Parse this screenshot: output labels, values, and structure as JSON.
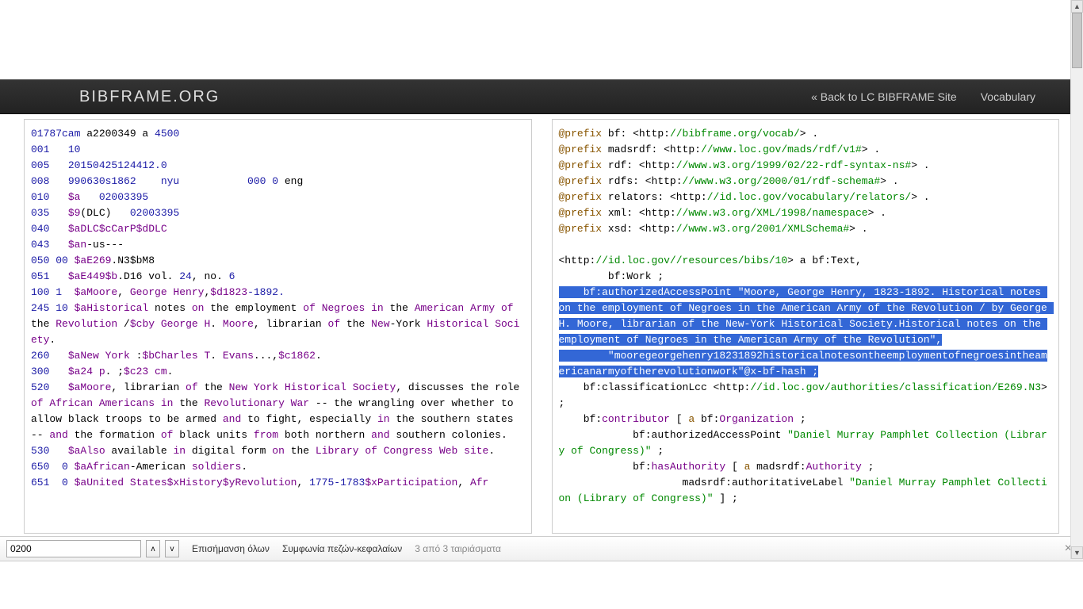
{
  "navbar": {
    "brand": "BIBFRAME.ORG",
    "back_link": "« Back to LC BIBFRAME Site",
    "vocab_link": "Vocabulary"
  },
  "marc": {
    "l1_a": "01787cam ",
    "l1_b": "a2200349 a ",
    "l1_c": "4500",
    "l2_a": "001   ",
    "l2_b": "10",
    "l3_a": "005   ",
    "l3_b": "20150425124412.0",
    "l4_a": "008   ",
    "l4_b": "990630s1862    nyu           000 0 ",
    "l4_c": "eng",
    "l5_a": "010   ",
    "l5_b": "$a   ",
    "l5_c": "02003395",
    "l6_a": "035   ",
    "l6_b": "$9",
    "l6_c": "(DLC)   ",
    "l6_d": "02003395",
    "l7_a": "040   ",
    "l7_b": "$aDLC$cCarP$dDLC",
    "l8_a": "043   ",
    "l8_b": "$an",
    "l8_c": "-us---",
    "l9_a": "050 00 ",
    "l9_b": "$aE269",
    "l9_c": ".N3$bM8",
    "l10_a": "051   ",
    "l10_b": "$aE449$b",
    "l10_c": ".D16 vol. ",
    "l10_d": "24",
    "l10_e": ", no. ",
    "l10_f": "6",
    "l11_a": "100 1  ",
    "l11_b": "$aMoore",
    "l11_c": ", ",
    "l11_d": "George Henry",
    "l11_e": ",",
    "l11_f": "$d1823",
    "l11_g": "-1892.",
    "l12_a": "245 10 ",
    "l12_b": "$aHistorical ",
    "l12_c": "notes ",
    "l12_d": "on ",
    "l12_e": "the ",
    "l12_f": "employment ",
    "l12_g": "of ",
    "l12_h": "Negroes ",
    "l12_i": "in ",
    "l12_j": "the ",
    "l12_k": "American Army ",
    "l12_l": "of ",
    "l12_m": "the ",
    "l12_n": "Revolution ",
    "l12_o": "/",
    "l12_p": "$cby George H",
    "l12_q": ". ",
    "l12_r": "Moore",
    "l12_s": ", ",
    "l12_t": "librarian ",
    "l12_u": "of ",
    "l12_v": "the ",
    "l12_w": "New",
    "l12_x": "-York ",
    "l12_y": "Historical Society",
    "l12_z": ".",
    "l13_a": "260   ",
    "l13_b": "$aNew York ",
    "l13_c": ":",
    "l13_d": "$bCharles T",
    "l13_e": ". ",
    "l13_f": "Evans",
    "l13_g": "...,",
    "l13_h": "$c1862",
    "l13_i": ".",
    "l14_a": "300   ",
    "l14_b": "$a24 p",
    "l14_c": ". ;",
    "l14_d": "$c23 cm",
    "l14_e": ".",
    "l15_a": "520   ",
    "l15_b": "$aMoore",
    "l15_c": ", ",
    "l15_d": "librarian ",
    "l15_e": "of ",
    "l15_f": "the ",
    "l15_g": "New York Historical Society",
    "l15_h": ", ",
    "l15_i": "discusses ",
    "l15_j": "the ",
    "l15_k": "role ",
    "l15_l": "of ",
    "l15_m": "African Americans in ",
    "l15_n": "the ",
    "l15_o": "Revolutionary War ",
    "l15_p": "-- ",
    "l15_q": "the ",
    "l15_r": "wrangling ",
    "l15_s": "over ",
    "l15_t": "whether ",
    "l15_u": "to ",
    "l15_v": "allow ",
    "l15_w": "black ",
    "l15_x": "troops ",
    "l15_y": "to ",
    "l15_z": "be ",
    "l15_aa": "armed ",
    "l15_ab": "and ",
    "l15_ac": "to ",
    "l15_ad": "fight",
    "l15_ae": ", ",
    "l15_af": "especially ",
    "l15_ag": "in ",
    "l15_ah": "the ",
    "l15_ai": "southern ",
    "l15_aj": "states ",
    "l15_ak": "-- ",
    "l15_al": "and ",
    "l15_am": "the ",
    "l15_an": "formation ",
    "l15_ao": "of ",
    "l15_ap": "black ",
    "l15_aq": "units ",
    "l15_ar": "from ",
    "l15_as": "both ",
    "l15_at": "northern ",
    "l15_au": "and ",
    "l15_av": "southern ",
    "l15_aw": "colonies",
    "l15_ax": ".",
    "l16_a": "530   ",
    "l16_b": "$aAlso ",
    "l16_c": "available ",
    "l16_d": "in ",
    "l16_e": "digital ",
    "l16_f": "form ",
    "l16_g": "on ",
    "l16_h": "the ",
    "l16_i": "Library ",
    "l16_j": "of ",
    "l16_k": "Congress Web site",
    "l16_l": ".",
    "l17_a": "650  0 ",
    "l17_b": "$aAfrican",
    "l17_c": "-American ",
    "l17_d": "soldiers",
    "l17_e": ".",
    "l18_a": "651  0 ",
    "l18_b": "$aUnited States$xHistory$yRevolution",
    "l18_c": ", ",
    "l18_d": "1775",
    "l18_e": "-1783",
    "l18_f": "$xParticipation",
    "l18_g": ", ",
    "l18_h": "Afr"
  },
  "turtle": {
    "p1": "@prefix",
    "bf_ns": " bf: <http:",
    "bf_url": "//bibframe.org/vocab/",
    "close": "> .",
    "mads_ns": " madsrdf: <http:",
    "mads_url": "//www.loc.gov/mads/rdf/v1#",
    "rdf_ns": " rdf: <http:",
    "rdf_url": "//www.w3.org/1999/02/22-rdf-syntax-ns#",
    "rdfs_ns": " rdfs: <http:",
    "rdfs_url": "//www.w3.org/2000/01/rdf-schema#",
    "rel_ns": " relators: <http:",
    "rel_url": "//id.loc.gov/vocabulary/relators/",
    "xml_ns": " xml: <http:",
    "xml_url": "//www.w3.org/XML/1998/namespace",
    "xsd_ns": " xsd: <http:",
    "xsd_url": "//www.w3.org/2001/XMLSchema#",
    "res1": "<http:",
    "res2": "//id.loc.gov//resources/bibs/10",
    "res3": "> a bf:Text,",
    "work": "        bf:Work ;",
    "aap": "    bf:authorizedAccessPoint \"Moore, George Henry, 1823-1892. Historical notes on the employment of Negroes in the American Army of the Revolution / by George H. Moore, librarian of the New-York Historical Society.Historical notes on the employment of Negroes in the American Army of the Revolution\",",
    "hash": "        \"mooregeorgehenry18231892historicalnotesontheemploymentofnegroesintheamericanarmyoftherevolutionwork\"@x-bf-hash ;",
    "cls1": "    bf:classificationLcc <http:",
    "cls2": "//id.loc.gov/authorities/classification/E269.N3",
    "cls3": "> ;",
    "con1": "    bf:",
    "con2": "contributor",
    "con3": " [ ",
    "con4": "a",
    "con5": " bf:",
    "con6": "Organization",
    "con7": " ;",
    "aap2a": "            bf:authorizedAccessPoint ",
    "aap2b": "\"Daniel Murray Pamphlet Collection (Library of Congress)\"",
    "aap2c": " ;",
    "ha1": "            bf:",
    "ha2": "hasAuthority",
    "ha3": " [ ",
    "ha4": "a",
    "ha5": " madsrdf:",
    "ha6": "Authority",
    "ha7": " ;",
    "al1": "                    madsrdf:authoritativeLabel ",
    "al2": "\"Daniel Murray Pamphlet Collection (Library of Congress)\"",
    "al3": " ] ;"
  },
  "findbar": {
    "value": "0200",
    "prev": "ʌ",
    "next": "v",
    "highlight": "Επισήμανση όλων",
    "case": "Συμφωνία πεζών-κεφαλαίων",
    "matches": "3 από 3 ταιριάσματα",
    "close": "×"
  }
}
